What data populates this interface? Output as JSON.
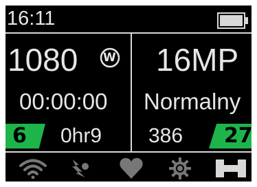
{
  "status_bar": {
    "time": "16:11",
    "battery_icon": "battery-icon"
  },
  "left_panel": {
    "resolution": "1080",
    "mode_badge": "W",
    "timer": "00:00:00",
    "video_count": "6",
    "remaining": "0hr9"
  },
  "right_panel": {
    "photo_resolution": "16MP",
    "photo_mode": "Normalny",
    "photos_remaining": "386",
    "photo_count": "27"
  },
  "bottom_icons": [
    {
      "name": "wifi-icon"
    },
    {
      "name": "interval-icon"
    },
    {
      "name": "heart-icon"
    },
    {
      "name": "settings-gear-icon"
    },
    {
      "name": "bar-icon"
    }
  ],
  "colors": {
    "background": "#000000",
    "text": "#e6e6e6",
    "accent": "#1db549",
    "icon_dim": "#777777"
  }
}
